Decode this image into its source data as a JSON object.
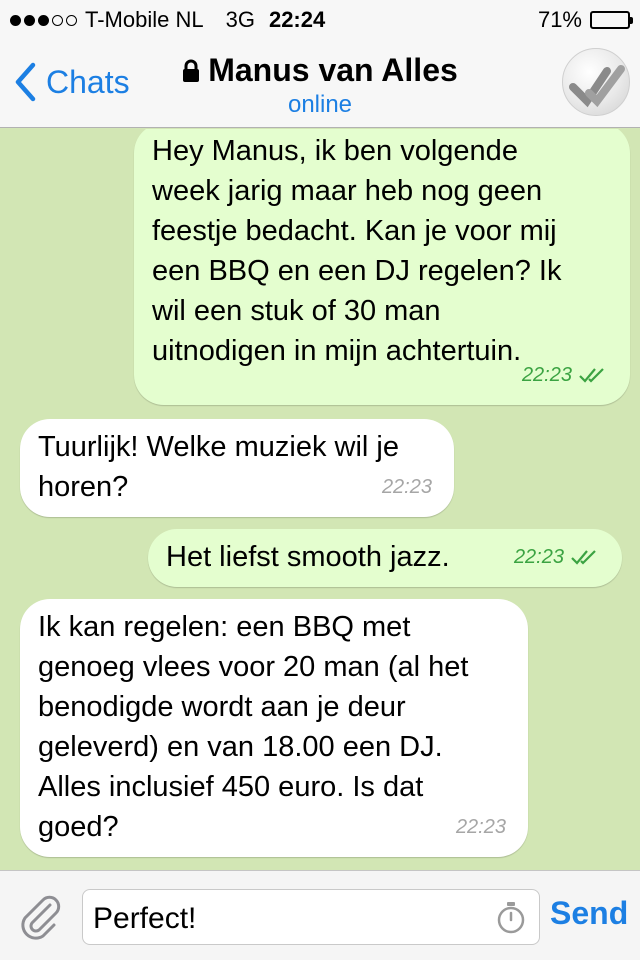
{
  "status_bar": {
    "carrier": "T-Mobile NL",
    "network": "3G",
    "time": "22:24",
    "battery": "71%",
    "battery_level": 0.71,
    "signal_full": 3,
    "signal_total": 5
  },
  "header": {
    "back_label": "Chats",
    "title": "Manus van Alles",
    "subtitle": "online",
    "accent_color": "#1c7fe3"
  },
  "messages": [
    {
      "direction": "out",
      "text": "Hey Manus, ik ben volgende\nweek jarig maar heb nog geen\nfeestje bedacht. Kan je voor mij\neen BBQ en een DJ regelen? Ik\nwil een stuk of 30 man\nuitnodigen in mijn achtertuin.",
      "time": "22:23",
      "read": true
    },
    {
      "direction": "in",
      "text": "Tuurlijk! Welke muziek wil je\nhoren?",
      "time": "22:23"
    },
    {
      "direction": "out",
      "text": "Het liefst smooth jazz.",
      "time": "22:23",
      "read": true
    },
    {
      "direction": "in",
      "text": "Ik kan regelen: een BBQ met\ngenoeg vlees voor 20 man (al het\nbenodigde wordt aan je deur\ngeleverd) en van 18.00 een DJ.\nAlles inclusief 450 euro. Is dat\ngoed?",
      "time": "22:23"
    }
  ],
  "input_bar": {
    "value": "Perfect!",
    "send_label": "Send"
  },
  "colors": {
    "chat_background": "#d2e6b4",
    "outgoing_bubble": "#e4fecf",
    "incoming_bubble": "#ffffff",
    "read_check": "#3ba342"
  },
  "icons": [
    "lock-icon",
    "chevron-left-icon",
    "paperclip-icon",
    "timer-icon",
    "double-check-icon"
  ]
}
